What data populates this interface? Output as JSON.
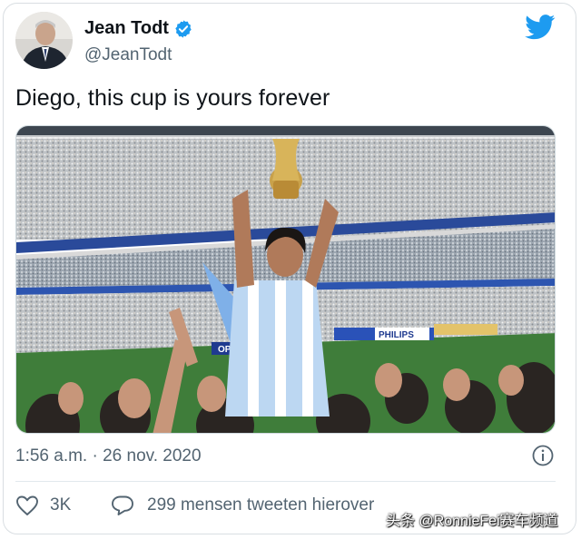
{
  "tweet": {
    "author": {
      "display_name": "Jean Todt",
      "handle": "@JeanTodt",
      "verified": true,
      "avatar_icon": "person-avatar"
    },
    "text": "Diego, this cup is yours forever",
    "media": {
      "type": "photo",
      "visible_text": [
        "PHILIPS",
        "OPE"
      ]
    },
    "timestamp": "1:56 a.m. · 26 nov. 2020",
    "likes": "3K",
    "retweets_label": "299 mensen tweeten hierover"
  },
  "icons": {
    "verified": "verified-badge-icon",
    "brand": "twitter-bird-icon",
    "info": "info-icon",
    "like": "heart-icon",
    "reply": "speech-bubble-icon"
  },
  "watermark": "头条 @RonnieFei赛车频道",
  "colors": {
    "twitter_blue": "#1d9bf0",
    "secondary_text": "#536471",
    "primary_text": "#0f1419"
  }
}
